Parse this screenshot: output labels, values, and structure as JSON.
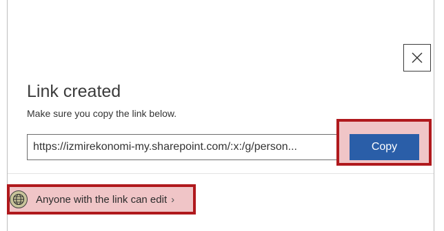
{
  "dialog": {
    "title": "Link created",
    "subtitle": "Make sure you copy the link below.",
    "link_value": "https://izmirekonomi-my.sharepoint.com/:x:/g/person...",
    "copy_label": "Copy",
    "permission_label": "Anyone with the link can edit",
    "chevron": "›",
    "close_icon": "close-icon",
    "globe_icon": "globe-icon"
  },
  "colors": {
    "primary_button": "#2a5ea8",
    "highlight_fill": "#f0c5c7",
    "highlight_border": "#b0191d"
  }
}
